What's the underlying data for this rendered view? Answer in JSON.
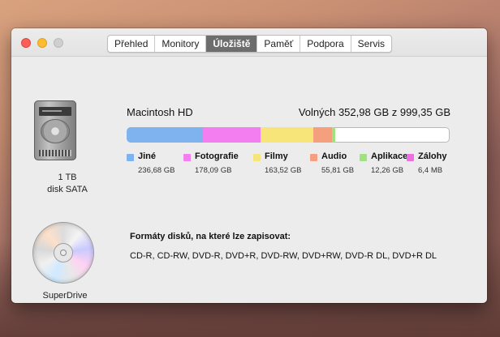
{
  "tabs": [
    {
      "label": "Přehled",
      "active": false
    },
    {
      "label": "Monitory",
      "active": false
    },
    {
      "label": "Úložiště",
      "active": true
    },
    {
      "label": "Paměť",
      "active": false
    },
    {
      "label": "Podpora",
      "active": false
    },
    {
      "label": "Servis",
      "active": false
    }
  ],
  "disk": {
    "capacity": "1 TB",
    "type": "disk SATA",
    "name": "Macintosh HD",
    "free_text": "Volných 352,98 GB z 999,35 GB",
    "total_gb": 999.35,
    "categories": [
      {
        "name": "Jiné",
        "size": "236,68 GB",
        "gb": 236.68,
        "color": "#7fb3ef"
      },
      {
        "name": "Fotografie",
        "size": "178,09 GB",
        "gb": 178.09,
        "color": "#f27ef0"
      },
      {
        "name": "Filmy",
        "size": "163,52 GB",
        "gb": 163.52,
        "color": "#f7e57a"
      },
      {
        "name": "Audio",
        "size": "55,81 GB",
        "gb": 55.81,
        "color": "#f4a07e"
      },
      {
        "name": "Aplikace",
        "size": "12,26 GB",
        "gb": 12.26,
        "color": "#9ee37f"
      },
      {
        "name": "Zálohy",
        "size": "6,4 MB",
        "gb": 0.0064,
        "color": "#ee6fe0"
      }
    ]
  },
  "superdrive": {
    "caption": "SuperDrive",
    "formats_title": "Formáty disků, na které lze zapisovat:",
    "formats": "CD-R, CD-RW, DVD-R, DVD+R, DVD-RW, DVD+RW, DVD-R DL, DVD+R DL"
  }
}
